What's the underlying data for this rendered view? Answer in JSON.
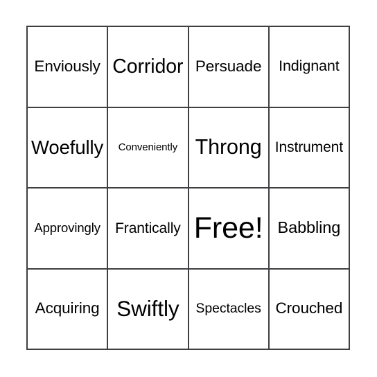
{
  "card": {
    "type": "bingo-card",
    "columns": 4,
    "rows": 4,
    "border_color": "#3f3f42",
    "background_color": "#ffffff",
    "text_color": "#000000",
    "free_space_index": 10,
    "cells": [
      {
        "label": "Enviously",
        "font_size": "22.5px",
        "free": false
      },
      {
        "label": "Corridor",
        "font_size": "28.5px",
        "free": false
      },
      {
        "label": "Persuade",
        "font_size": "22.5px",
        "free": false
      },
      {
        "label": "Indignant",
        "font_size": "21.5px",
        "free": false
      },
      {
        "label": "Woefully",
        "font_size": "27.5px",
        "free": false
      },
      {
        "label": "Conveniently",
        "font_size": "15px",
        "free": false
      },
      {
        "label": "Throng",
        "font_size": "30.5px",
        "free": false
      },
      {
        "label": "Instrument",
        "font_size": "21px",
        "free": false
      },
      {
        "label": "Approvingly",
        "font_size": "18.5px",
        "free": false
      },
      {
        "label": "Frantically",
        "font_size": "21px",
        "free": false
      },
      {
        "label": "Free!",
        "font_size": "43px",
        "free": true
      },
      {
        "label": "Babbling",
        "font_size": "23.5px",
        "free": false
      },
      {
        "label": "Acquiring",
        "font_size": "22.5px",
        "free": false
      },
      {
        "label": "Swiftly",
        "font_size": "31.5px",
        "free": false
      },
      {
        "label": "Spectacles",
        "font_size": "19.5px",
        "free": false
      },
      {
        "label": "Crouched",
        "font_size": "22.5px",
        "free": false
      }
    ]
  }
}
